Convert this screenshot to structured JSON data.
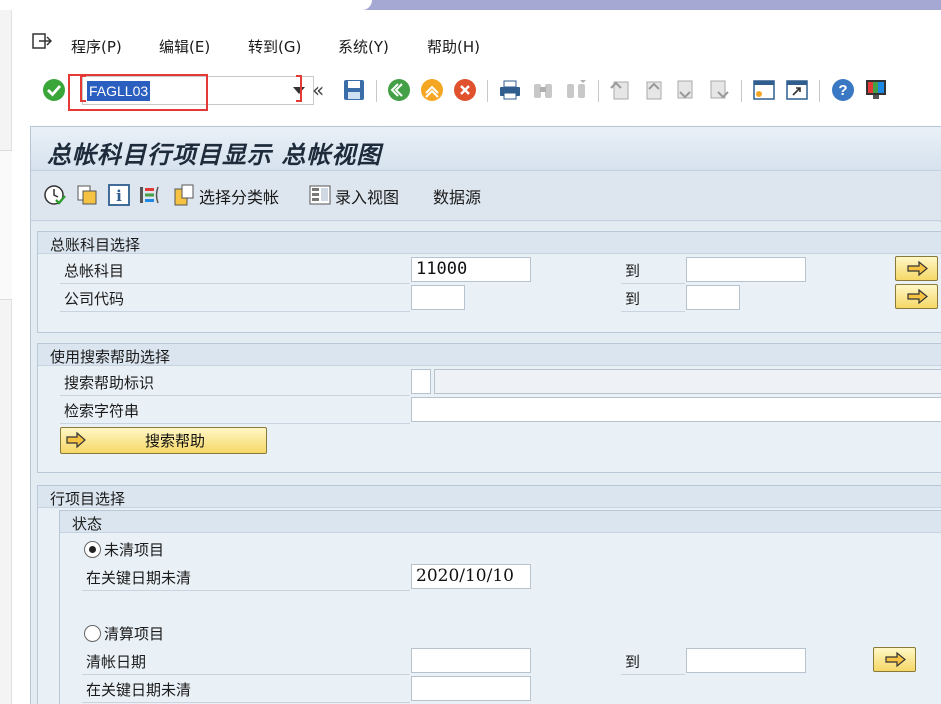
{
  "menubar": {
    "items": [
      {
        "label": "程序(P)"
      },
      {
        "label": "编辑(E)"
      },
      {
        "label": "转到(G)"
      },
      {
        "label": "系统(Y)"
      },
      {
        "label": "帮助(H)"
      }
    ]
  },
  "toolbar": {
    "command_value": "FAGLL03",
    "back_chevron": "«"
  },
  "screen": {
    "title": "总帐科目行项目显示 总帐视图"
  },
  "app_toolbar": {
    "select_ledger": "选择分类帐",
    "entry_view": "录入视图",
    "data_source": "数据源"
  },
  "gl_selection": {
    "title": "总账科目选择",
    "account_label": "总帐科目",
    "account_value": "11000",
    "account_to_label": "到",
    "account_to_value": "",
    "company_label": "公司代码",
    "company_value": "",
    "company_to_label": "到",
    "company_to_value": ""
  },
  "search_help": {
    "title": "使用搜索帮助选择",
    "id_label": "搜索帮助标识",
    "string_label": "检索字符串",
    "button_label": "搜索帮助"
  },
  "line_items": {
    "title": "行项目选择",
    "status_title": "状态",
    "open_label": "未清项目",
    "open_key_date_label": "在关键日期未清",
    "open_key_date_value": "2020/10/10",
    "cleared_label": "清算项目",
    "clearing_date_label": "清帐日期",
    "clearing_to_label": "到",
    "cleared_key_date_label": "在关键日期未清"
  },
  "colors": {
    "accent_blue": "#2a5fbf",
    "highlight_red": "#e53935",
    "panel_bg": "#dfe8f1",
    "button_yellow": "#f6d867"
  }
}
